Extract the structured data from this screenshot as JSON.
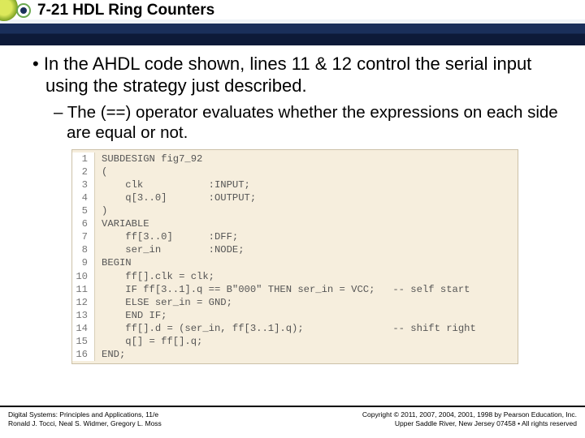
{
  "header": {
    "title": "7-21 HDL Ring Counters"
  },
  "bullets": {
    "p1": "In the AHDL code shown, lines 11 & 12 control the serial input using the strategy just described.",
    "p2": "The (==) operator evaluates whether the expressions on each side are equal or not."
  },
  "code": {
    "lines": [
      "SUBDESIGN fig7_92",
      "(",
      "    clk           :INPUT;",
      "    q[3..0]       :OUTPUT;",
      ")",
      "VARIABLE",
      "    ff[3..0]      :DFF;",
      "    ser_in        :NODE;",
      "BEGIN",
      "    ff[].clk = clk;",
      "    IF ff[3..1].q == B\"000\" THEN ser_in = VCC;   -- self start",
      "    ELSE ser_in = GND;",
      "    END IF;",
      "    ff[].d = (ser_in, ff[3..1].q);               -- shift right",
      "    q[] = ff[].q;",
      "END;"
    ]
  },
  "footer": {
    "left1": "Digital Systems: Principles and Applications, 11/e",
    "left2": "Ronald J. Tocci, Neal S. Widmer, Gregory L. Moss",
    "right1": "Copyright © 2011, 2007, 2004, 2001, 1998 by Pearson Education, Inc.",
    "right2": "Upper Saddle River, New Jersey 07458 • All rights reserved"
  }
}
